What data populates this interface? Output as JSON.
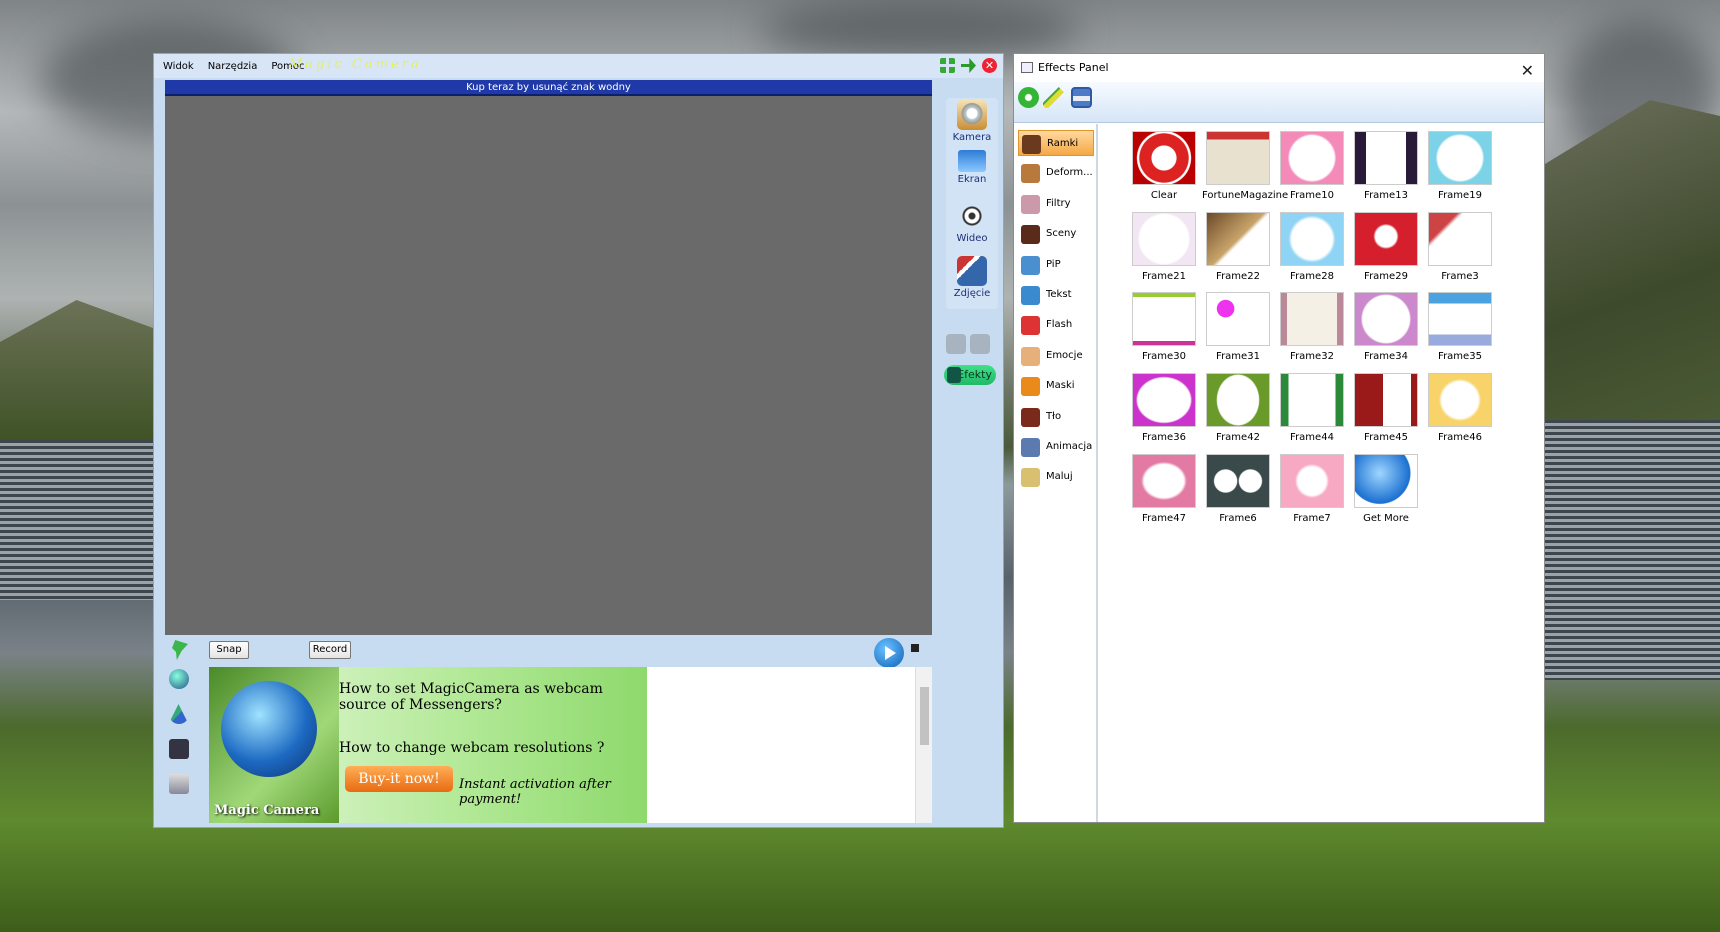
{
  "magic_camera": {
    "menu": [
      "Widok",
      "Narzędzia",
      "Pomoc"
    ],
    "brand": "Magic Camera",
    "watermark": "Kup teraz by usunąć znak wodny",
    "side": [
      {
        "label": "Kamera",
        "icon": "webcam-icon"
      },
      {
        "label": "Ekran",
        "icon": "monitor-icon"
      },
      {
        "label": "Wideo",
        "icon": "film-reel-icon"
      },
      {
        "label": "Zdjęcie",
        "icon": "photo-icon"
      }
    ],
    "efekty": "Efekty",
    "snap": "Snap",
    "record": "Record",
    "ad": {
      "box_name": "Magic Camera",
      "q1": "How to set MagicCamera as webcam source of Messengers?",
      "q2": "How to change webcam resolutions ?",
      "buy": "Buy-it now!",
      "instant": "Instant activation after payment!"
    }
  },
  "effects_panel": {
    "title": "Effects Panel",
    "close": "✕",
    "categories": [
      {
        "label": "Ramki",
        "color": "#6b3a1e",
        "selected": true
      },
      {
        "label": "Deform...",
        "color": "#b87a3c"
      },
      {
        "label": "Filtry",
        "color": "#c9a"
      },
      {
        "label": "Sceny",
        "color": "#5a2a1a"
      },
      {
        "label": "PiP",
        "color": "#4a90d0"
      },
      {
        "label": "Tekst",
        "color": "#3a8ad0"
      },
      {
        "label": "Flash",
        "color": "#d33"
      },
      {
        "label": "Emocje",
        "color": "#e7b07a"
      },
      {
        "label": "Maski",
        "color": "#e98a1a"
      },
      {
        "label": "Tło",
        "color": "#7a2a1a"
      },
      {
        "label": "Animacja",
        "color": "#5a7ab0"
      },
      {
        "label": "Maluj",
        "color": "#d8c070"
      }
    ],
    "frames": [
      {
        "label": "Clear",
        "bg": "radial-gradient(circle,#fff 0 30%,#d22 32% 60%,#fff 62% 66%,#b00 68%)"
      },
      {
        "label": "FortuneMagazine",
        "bg": "linear-gradient(#c33 0 14%,#e9e1cf 14%)"
      },
      {
        "label": "Frame10",
        "bg": "radial-gradient(circle,#fff 0 55%,#f48ab7 60%)"
      },
      {
        "label": "Frame13",
        "bg": "linear-gradient(90deg,#2a1a3a 0 18%,#fff 18% 82%,#2a1a3a 82%)"
      },
      {
        "label": "Frame19",
        "bg": "radial-gradient(circle,#fff 0 55%,#7cd3e8 60%)"
      },
      {
        "label": "Frame21",
        "bg": "radial-gradient(circle,#fff 0 60%,#f2e6f2 65%)"
      },
      {
        "label": "Frame22",
        "bg": "linear-gradient(135deg,#6b4a28,#c9a46a 50%,#fff 55%)"
      },
      {
        "label": "Frame28",
        "bg": "radial-gradient(circle,#fff 0 50%,#8fd4f5 58%)"
      },
      {
        "label": "Frame29",
        "bg": "radial-gradient(circle at 50% 45%,#fff 0 25%,#d61f2d 30%)"
      },
      {
        "label": "Frame3",
        "bg": "linear-gradient(135deg,#c44 0 25%,#fff 30%)"
      },
      {
        "label": "Frame30",
        "bg": "linear-gradient(#9c3 0 8%,#fff 8% 92%,#c39 92%)"
      },
      {
        "label": "Frame31",
        "bg": "radial-gradient(circle at 30% 30%,#e3e 0 15%,#fff 16%)"
      },
      {
        "label": "Frame32",
        "bg": "linear-gradient(90deg,#b89 0 10%,#f4f0e6 10% 90%,#b89 90%)"
      },
      {
        "label": "Frame34",
        "bg": "radial-gradient(circle,#fff 0 58%,#c8c 62%)"
      },
      {
        "label": "Frame35",
        "bg": "linear-gradient(#4aa3e0 0 20%,#fff 20% 80%,#9ad 80%)"
      },
      {
        "label": "Frame36",
        "bg": "radial-gradient(#fff 0 60%,#c3c 64%)"
      },
      {
        "label": "Frame42",
        "bg": "radial-gradient(ellipse 35% 50%,#fff 0 95%,#6a9a2a 100%)"
      },
      {
        "label": "Frame44",
        "bg": "linear-gradient(90deg,#2a8a3a 0 12%,#fff 12% 88%,#2a8a3a 88%)"
      },
      {
        "label": "Frame45",
        "bg": "linear-gradient(90deg,#9a1a1a 0 45%,#fff 45% 90%,#9a1a1a 90%)"
      },
      {
        "label": "Frame46",
        "bg": "radial-gradient(circle,#fff 0 45%,#f7d36a 52%)"
      },
      {
        "label": "Frame47",
        "bg": "radial-gradient(ellipse,#fff 0 45%,#e27aa3 52%)"
      },
      {
        "label": "Frame6",
        "bg": "radial-gradient(circle at 30% 50%,#fff 0 22%,transparent 24%),radial-gradient(circle at 70% 50%,#fff 0 22%,#3a4a4a 24%)"
      },
      {
        "label": "Frame7",
        "bg": "radial-gradient(circle at 50% 50%,#fff 0 35%,#f7a9c3 42%)"
      },
      {
        "label": "Get More",
        "bg": "radial-gradient(circle at 40% 35%,#9fd6ff,#1a6fd0 60%,#fff 62%)"
      }
    ]
  }
}
